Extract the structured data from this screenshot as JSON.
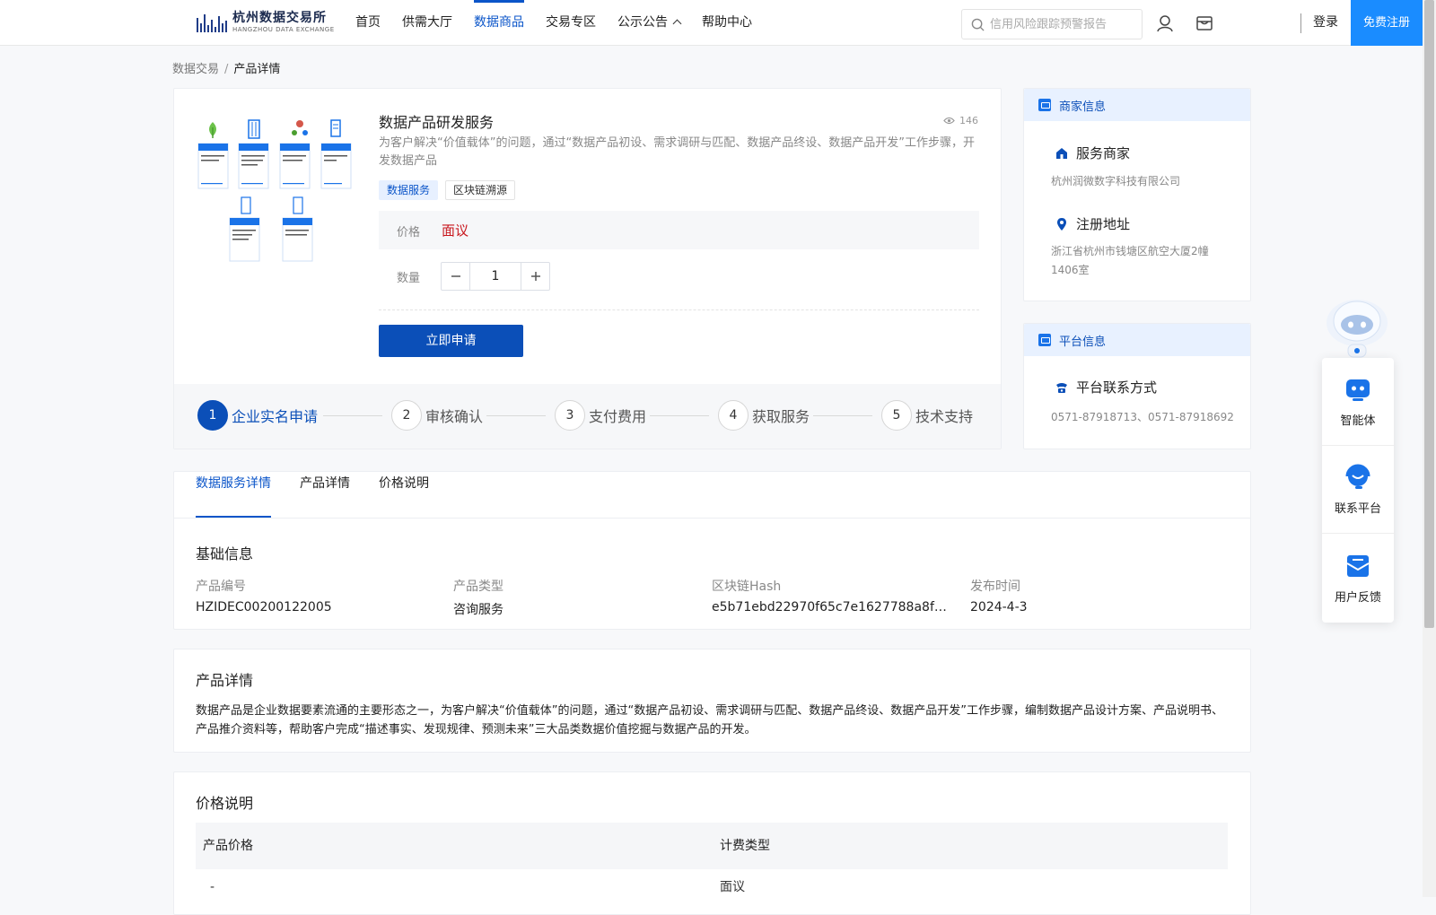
{
  "header": {
    "logo_cn": "杭州数据交易所",
    "logo_en": "HANGZHOU DATA EXCHANGE",
    "nav": [
      {
        "label": "首页",
        "active": false
      },
      {
        "label": "供需大厅",
        "active": false
      },
      {
        "label": "数据商品",
        "active": true
      },
      {
        "label": "交易专区",
        "active": false
      },
      {
        "label": "公示公告",
        "active": false
      },
      {
        "label": "帮助中心",
        "active": false
      }
    ],
    "search_placeholder": "信用风险跟踪预警报告",
    "login": "登录",
    "register": "免费注册"
  },
  "breadcrumb": {
    "parent": "数据交易",
    "separator": "/",
    "current": "产品详情"
  },
  "product": {
    "title": "数据产品研发服务",
    "views": "146",
    "desc": "为客户解决“价值载体”的问题，通过“数据产品初设、需求调研与匹配、数据产品终设、数据产品开发”工作步骤，开发数据产品",
    "tags": [
      {
        "label": "数据服务",
        "primary": true
      },
      {
        "label": "区块链溯源",
        "primary": false
      }
    ],
    "price_label": "价格",
    "price_value": "面议",
    "qty_label": "数量",
    "qty_value": "1",
    "apply_label": "立即申请"
  },
  "steps": [
    {
      "num": "1",
      "label": "企业实名申请",
      "active": true
    },
    {
      "num": "2",
      "label": "审核确认",
      "active": false
    },
    {
      "num": "3",
      "label": "支付费用",
      "active": false
    },
    {
      "num": "4",
      "label": "获取服务",
      "active": false
    },
    {
      "num": "5",
      "label": "技术支持",
      "active": false
    }
  ],
  "merchant": {
    "header": "商家信息",
    "service_title": "服务商家",
    "service_value": "杭州润微数字科技有限公司",
    "address_title": "注册地址",
    "address_value": "浙江省杭州市钱塘区航空大厦2幢1406室"
  },
  "platform": {
    "header": "平台信息",
    "contact_title": "平台联系方式",
    "contact_value": "0571-87918713、0571-87918692"
  },
  "tabs": [
    {
      "label": "数据服务详情",
      "active": true
    },
    {
      "label": "产品详情",
      "active": false
    },
    {
      "label": "价格说明",
      "active": false
    }
  ],
  "basic_info": {
    "title": "基础信息",
    "fields": [
      {
        "key": "产品编号",
        "value": "HZIDEC00200122005"
      },
      {
        "key": "产品类型",
        "value": "咨询服务"
      },
      {
        "key": "区块链Hash",
        "value": "e5b71ebd22970f65c7e1627788a8fa28a2..."
      },
      {
        "key": "发布时间",
        "value": "2024-4-3"
      }
    ]
  },
  "product_detail": {
    "title": "产品详情",
    "text": "数据产品是企业数据要素流通的主要形态之一，为客户解决“价值载体”的问题，通过“数据产品初设、需求调研与匹配、数据产品终设、数据产品开发”工作步骤，编制数据产品设计方案、产品说明书、产品推介资料等，帮助客户完成“描述事实、发现规律、预测未来”三大品类数据价值挖掘与数据产品的开发。"
  },
  "price_info": {
    "title": "价格说明",
    "headers": [
      "产品价格",
      "计费类型"
    ],
    "rows": [
      [
        "-",
        "面议"
      ]
    ]
  },
  "float_panel": {
    "items": [
      {
        "label": "智能体",
        "icon": "agent-icon"
      },
      {
        "label": "联系平台",
        "icon": "headset-icon"
      },
      {
        "label": "用户反馈",
        "icon": "feedback-icon"
      }
    ]
  },
  "colors": {
    "primary": "#0b4fb8",
    "accent": "#1a8cff",
    "price": "#c8161d"
  }
}
